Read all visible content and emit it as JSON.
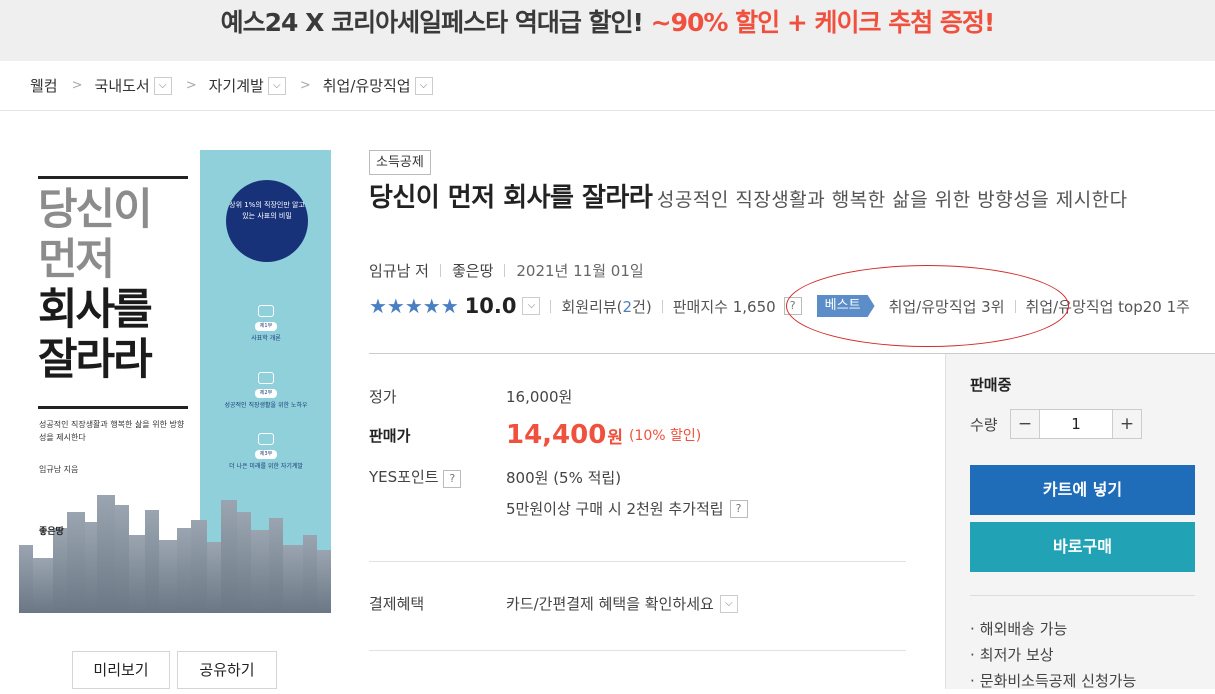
{
  "banner": {
    "part1": "예스24 X 코리아세일페스타 역대급 할인!",
    "part2": "~90% 할인 + 케이크 추첨 증정!"
  },
  "breadcrumb": {
    "home": "웰컴",
    "items": [
      "국내도서",
      "자기계발",
      "취업/유망직업"
    ]
  },
  "cover": {
    "title_lines": [
      "당신이",
      "먼저",
      "회사를",
      "잘라라"
    ],
    "subtitle": "성공적인 직장생활과 행복한 삶을 위한 방향성을 제시한다",
    "author": "임규남 지음",
    "publisher": "좋은땅",
    "seal": "상위 1%의 직장인만 알고 있는 사표의 비밀",
    "parts": [
      {
        "label": "제1부",
        "text": "사표학 개론"
      },
      {
        "label": "제2부",
        "text": "성공적인 직장생활을 위한 노하우"
      },
      {
        "label": "제3부",
        "text": "더 나은 미래를 위한 자기계발"
      }
    ]
  },
  "buttons": {
    "preview": "미리보기",
    "share": "공유하기"
  },
  "product": {
    "tag": "소득공제",
    "title": "당신이 먼저 회사를 잘라라",
    "subtitle": "성공적인 직장생활과 행복한 삶을 위한 방향성을 제시한다",
    "author": "임규남 저",
    "publisher": "좋은땅",
    "date": "2021년 11월 01일"
  },
  "rating": {
    "stars": "★★★★★",
    "score": "10.0",
    "review_prefix": "회원리뷰(",
    "review_count": "2",
    "review_suffix": "건)",
    "sales_label": "판매지수 1,650",
    "best_badge": "베스트",
    "rank1": "취업/유망직업 3위",
    "rank2": "취업/유망직업 top20 1주"
  },
  "pricing": {
    "list_label": "정가",
    "list_value": "16,000원",
    "sale_label": "판매가",
    "sale_value": "14,400",
    "sale_unit": "원",
    "discount": "(10% 할인)",
    "points_label": "YES포인트",
    "points_value": "800원 (5% 적립)",
    "points_extra": "5만원이상 구매 시 2천원 추가적립",
    "benefit_label": "결제혜택",
    "benefit_value": "카드/간편결제 혜택을 확인하세요"
  },
  "side": {
    "status": "판매중",
    "qty_label": "수량",
    "qty_value": "1",
    "minus": "−",
    "plus": "+",
    "cart": "카트에 넣기",
    "buy": "바로구매",
    "features": [
      "해외배송 가능",
      "최저가 보상",
      "문화비소득공제 신청가능"
    ]
  },
  "colors": {
    "accent_blue": "#1f6cb8",
    "teal": "#21a3b5",
    "sale_red": "#f0513e",
    "star_blue": "#4a7fc1"
  }
}
